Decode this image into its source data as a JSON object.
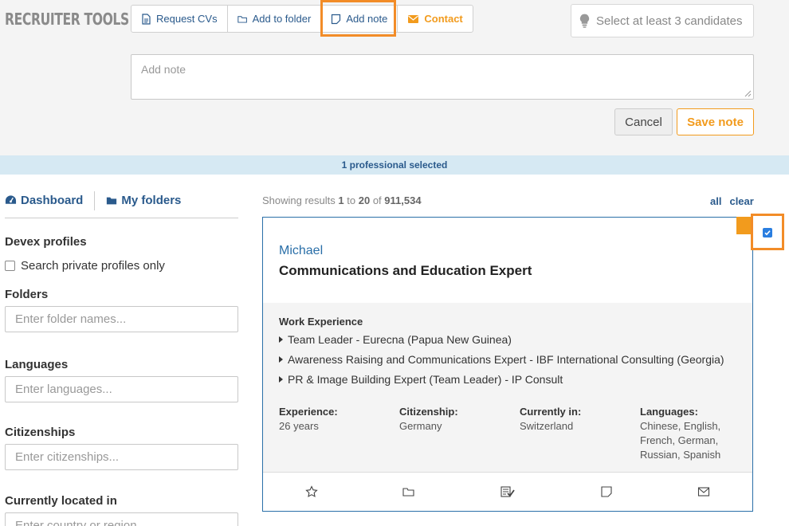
{
  "brand": "Recruiter Tools",
  "toolbar": {
    "request_cvs": "Request CVs",
    "add_to_folder": "Add to folder",
    "add_note": "Add note",
    "contact": "Contact"
  },
  "tip": "Select at least 3 candidates",
  "note": {
    "placeholder": "Add note",
    "cancel": "Cancel",
    "save": "Save note"
  },
  "selection_bar": "1 professional selected",
  "nav": {
    "dashboard": "Dashboard",
    "folders": "My folders"
  },
  "filters": {
    "devex_profiles": "Devex profiles",
    "private_only": "Search private profiles only",
    "folders_label": "Folders",
    "folders_placeholder": "Enter folder names...",
    "languages_label": "Languages",
    "languages_placeholder": "Enter languages...",
    "citizenships_label": "Citizenships",
    "citizenships_placeholder": "Enter citizenships...",
    "located_label": "Currently located in",
    "located_placeholder": "Enter country or region..."
  },
  "results": {
    "prefix": "Showing results",
    "from": "1",
    "to_word": "to",
    "to": "20",
    "of_word": "of",
    "total": "911,534",
    "all": "all",
    "clear": "clear"
  },
  "candidate": {
    "name": "Michael",
    "title": "Communications and Education Expert",
    "work_experience_label": "Work Experience",
    "work_experience": [
      "Team Leader - Eurecna (Papua New Guinea)",
      "Awareness Raising and Communications Expert - IBF International Consulting (Georgia)",
      "PR & Image Building Expert (Team Leader) - IP Consult"
    ],
    "experience_label": "Experience:",
    "experience": "26 years",
    "citizenship_label": "Citizenship:",
    "citizenship": "Germany",
    "currently_in_label": "Currently in:",
    "currently_in": "Switzerland",
    "languages_label": "Languages:",
    "languages": "Chinese, English, French, German, Russian, Spanish",
    "selected": true
  },
  "colors": {
    "accent": "#f29b1d",
    "link": "#2a5a8c",
    "highlight": "#f28c28"
  }
}
